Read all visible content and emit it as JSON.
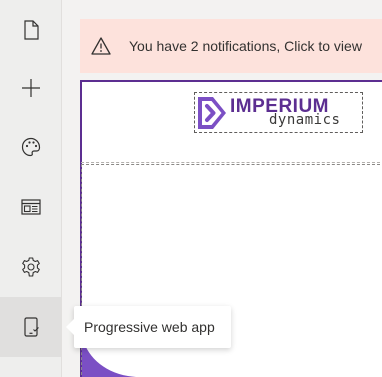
{
  "sidebar": {
    "items": [
      {
        "icon": "page-icon"
      },
      {
        "icon": "add-icon"
      },
      {
        "icon": "palette-icon"
      },
      {
        "icon": "layout-icon"
      },
      {
        "icon": "gear-icon"
      },
      {
        "icon": "mobile-app-icon",
        "active": true
      }
    ]
  },
  "banner": {
    "icon": "warning-icon",
    "text": "You have 2 notifications, Click to view"
  },
  "canvas": {
    "logo": {
      "word1": "IMPERIUM",
      "word2": "dynamics"
    }
  },
  "tooltip": {
    "text": "Progressive web app"
  },
  "colors": {
    "accent": "#5c2e91",
    "logo_purple": "#7b4fc4",
    "banner_bg": "#fde2dc"
  }
}
